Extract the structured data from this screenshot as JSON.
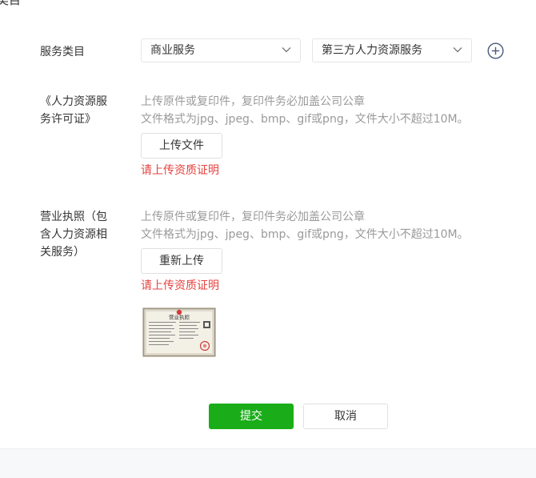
{
  "page": {
    "title": "类目"
  },
  "service_category": {
    "label": "服务类目",
    "primary_value": "商业服务",
    "secondary_value": "第三方人力资源服务",
    "icons": {
      "chevron": "chevron-down-icon",
      "add": "add-circle-icon"
    }
  },
  "hr_license": {
    "label_line1": "《人力资源服",
    "label_line2": "务许可证》",
    "hint_line1": "上传原件或复印件，复印件务必加盖公司公章",
    "hint_line2": "文件格式为jpg、jpeg、bmp、gif或png，文件大小不超过10M。",
    "button": "上传文件",
    "error": "请上传资质证明"
  },
  "business_license": {
    "label_line1": "营业执照（包",
    "label_line2": "含人力资源相",
    "label_line3": "关服务）",
    "hint_line1": "上传原件或复印件，复印件务必加盖公司公章",
    "hint_line2": "文件格式为jpg、jpeg、bmp、gif或png，文件大小不超过10M。",
    "button": "重新上传",
    "error": "请上传资质证明",
    "thumbnail_title": "营业执照"
  },
  "actions": {
    "submit": "提交",
    "cancel": "取消"
  },
  "colors": {
    "primary": "#1aad19",
    "error": "#e64340",
    "hint": "#9a9a9a",
    "border": "#e4e6e9"
  }
}
